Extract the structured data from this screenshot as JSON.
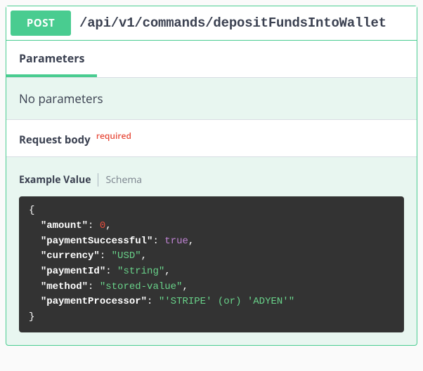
{
  "endpoint": {
    "method": "POST",
    "path": "/api/v1/commands/depositFundsIntoWallet"
  },
  "tabs": {
    "parameters": "Parameters"
  },
  "params": {
    "none": "No parameters"
  },
  "requestBody": {
    "label": "Request body",
    "required": "required"
  },
  "exampleTabs": {
    "example": "Example Value",
    "schema": "Schema"
  },
  "json": {
    "brace_open": "{",
    "brace_close": "}",
    "lines": [
      {
        "key": "\"amount\"",
        "colon": ": ",
        "val": "0",
        "cls": "tok-num",
        "comma": ","
      },
      {
        "key": "\"paymentSuccessful\"",
        "colon": ": ",
        "val": "true",
        "cls": "tok-bool",
        "comma": ","
      },
      {
        "key": "\"currency\"",
        "colon": ": ",
        "val": "\"USD\"",
        "cls": "tok-str",
        "comma": ","
      },
      {
        "key": "\"paymentId\"",
        "colon": ": ",
        "val": "\"string\"",
        "cls": "tok-str",
        "comma": ","
      },
      {
        "key": "\"method\"",
        "colon": ": ",
        "val": "\"stored-value\"",
        "cls": "tok-str",
        "comma": ","
      },
      {
        "key": "\"paymentProcessor\"",
        "colon": ": ",
        "val": "\"'STRIPE' (or) 'ADYEN'\"",
        "cls": "tok-str",
        "comma": ""
      }
    ]
  }
}
